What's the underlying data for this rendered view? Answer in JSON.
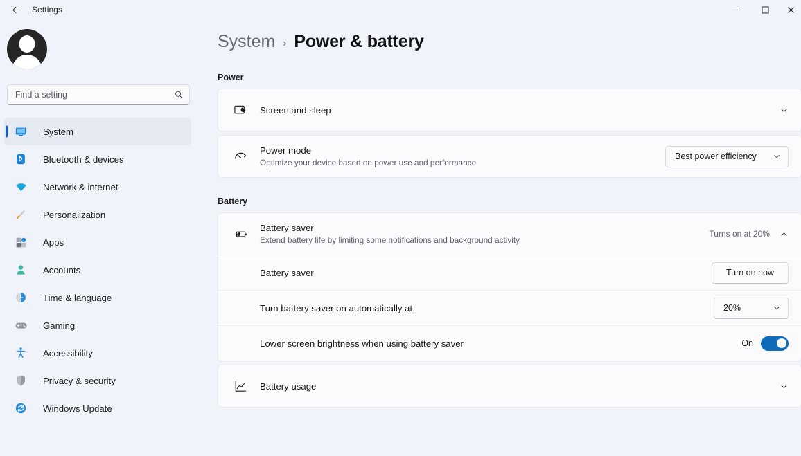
{
  "titlebar": {
    "back_icon": "back-arrow-icon",
    "title": "Settings",
    "minimize_label": "—",
    "maximize_label": "☐",
    "close_label": "✕"
  },
  "sidebar": {
    "avatar": "user-avatar",
    "search": {
      "value": "",
      "placeholder": "Find a setting",
      "icon": "search-icon"
    },
    "items": [
      {
        "label": "System",
        "icon": "monitor-icon",
        "selected": true
      },
      {
        "label": "Bluetooth & devices",
        "icon": "bluetooth-icon",
        "selected": false
      },
      {
        "label": "Network & internet",
        "icon": "wifi-icon",
        "selected": false
      },
      {
        "label": "Personalization",
        "icon": "paintbrush-icon",
        "selected": false
      },
      {
        "label": "Apps",
        "icon": "apps-grid-icon",
        "selected": false
      },
      {
        "label": "Accounts",
        "icon": "person-icon",
        "selected": false
      },
      {
        "label": "Time & language",
        "icon": "clock-icon",
        "selected": false
      },
      {
        "label": "Gaming",
        "icon": "gamepad-icon",
        "selected": false
      },
      {
        "label": "Accessibility",
        "icon": "accessibility-icon",
        "selected": false
      },
      {
        "label": "Privacy & security",
        "icon": "shield-icon",
        "selected": false
      },
      {
        "label": "Windows Update",
        "icon": "update-arrows-icon",
        "selected": false
      }
    ]
  },
  "breadcrumb": {
    "parent": "System",
    "separator": "›",
    "current": "Power & battery"
  },
  "power_section": {
    "title": "Power",
    "screen_and_sleep": {
      "title": "Screen and sleep",
      "icon": "screen-sleep-icon",
      "chevron": "chevron-down-icon"
    },
    "power_mode": {
      "title": "Power mode",
      "subtitle": "Optimize your device based on power use and performance",
      "icon": "power-gauge-icon",
      "value": "Best power efficiency",
      "chevron": "chevron-down-icon"
    }
  },
  "battery_section": {
    "title": "Battery",
    "battery_saver": {
      "title": "Battery saver",
      "subtitle": "Extend battery life by limiting some notifications and background activity",
      "icon": "battery-saver-icon",
      "status": "Turns on at 20%",
      "chevron": "chevron-up-icon"
    },
    "sub_rows": {
      "toggle_row": {
        "title": "Battery saver",
        "button_label": "Turn on now"
      },
      "auto_row": {
        "title": "Turn battery saver on automatically at",
        "value": "20%",
        "chevron": "chevron-down-icon"
      },
      "brightness_row": {
        "title": "Lower screen brightness when using battery saver",
        "toggle_label": "On",
        "toggle_state": "on"
      }
    },
    "battery_usage": {
      "title": "Battery usage",
      "icon": "line-chart-icon",
      "chevron": "chevron-down-icon"
    }
  },
  "colors": {
    "accent": "#0f5fc2",
    "toggle_on": "#0f6cbd",
    "background": "#f0f3f9",
    "card": "#fbfbfd"
  }
}
